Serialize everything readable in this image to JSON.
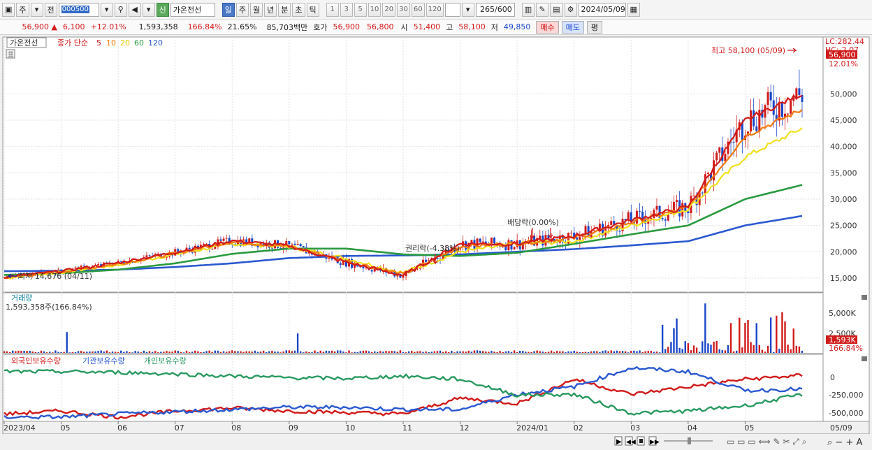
{
  "toolbar": {
    "market_label": "주",
    "prev_label": "전",
    "symbol_code": "000500",
    "new_badge": "신",
    "stock_name": "가온전선",
    "period_buttons": [
      "일",
      "주",
      "월",
      "년",
      "분",
      "초",
      "틱"
    ],
    "interval_buttons": [
      "1",
      "3",
      "5",
      "10",
      "20",
      "30",
      "60",
      "120"
    ],
    "count_value": "265",
    "count_total": "/600",
    "date_value": "2024/05/09"
  },
  "quote": {
    "price": "56,900",
    "change_arrow": "▲",
    "change": "6,100",
    "change_pct": "+12.01%",
    "volume": "1,593,358",
    "volume_ratio": "166.84%",
    "turnover_rate": "21.65%",
    "amount": "85,703백만",
    "bid_label": "호가",
    "ask_price": "56,900",
    "bid_price": "56,800",
    "open_label": "시",
    "open": "51,400",
    "high_label": "고",
    "high": "58,100",
    "low_label": "저",
    "low": "49,850",
    "buy_button": "매수",
    "sell_button": "매도",
    "eval_button": "평"
  },
  "price_panel": {
    "stock_name_tag": "가온전선",
    "ma_label_main": "종가 단순",
    "ma_periods": [
      "5",
      "10",
      "20",
      "60",
      "120"
    ],
    "ma_colors": [
      "#d11a1a",
      "#f07a10",
      "#f0e020",
      "#2a9a40",
      "#2a58d0"
    ],
    "lc_label": "LC:282.44",
    "hc_label": "HC:-2.07",
    "current_price_tag": "56,900",
    "current_pct_tag": "12.01%",
    "high_annotation": "최고 58,100 (05/09)",
    "low_annotation": "최저 14,676 (04/11)",
    "event_rights": "권리락(-4.38%)",
    "event_dividend": "배당락(0.00%)",
    "y_ticks": [
      "50,000",
      "45,000",
      "40,000",
      "35,000",
      "30,000",
      "25,000",
      "20,000",
      "15,000"
    ]
  },
  "volume_panel": {
    "title": "거래량",
    "value_text": "1,593,358주(166.84%)",
    "y_ticks": [
      "5,000K",
      "2,500K"
    ],
    "current_tag": "1,593K",
    "current_pct_tag": "166.84%"
  },
  "holdings_panel": {
    "legend": [
      "외국인보유수량",
      "기관보유수량",
      "개인보유수량"
    ],
    "legend_colors": [
      "#d11a1a",
      "#2a58d0",
      "#2a9a60"
    ],
    "y_ticks": [
      "0",
      "-250,000",
      "-500,000"
    ]
  },
  "x_axis": {
    "labels": [
      "2023/04",
      "05",
      "06",
      "07",
      "08",
      "09",
      "10",
      "11",
      "12",
      "2024/01",
      "02",
      "03",
      "04",
      "05"
    ],
    "right_label": "05/09"
  },
  "chart_data": {
    "type": "line",
    "title": "",
    "xlabel": "",
    "ylabel": "",
    "x": [
      "2023/04",
      "05",
      "06",
      "07",
      "08",
      "09",
      "10",
      "11",
      "12",
      "2024/01",
      "02",
      "03",
      "04",
      "05",
      "05/09"
    ],
    "ylim": [
      13000,
      60000
    ],
    "series": [
      {
        "name": "5",
        "values": [
          15200,
          16300,
          17900,
          19900,
          22100,
          21100,
          18000,
          15500,
          21500,
          21500,
          23000,
          26000,
          28500,
          45000,
          50000
        ]
      },
      {
        "name": "10",
        "values": [
          15100,
          16200,
          17700,
          19700,
          21900,
          21000,
          18300,
          15700,
          21000,
          21600,
          22600,
          25600,
          28400,
          42000,
          47000
        ]
      },
      {
        "name": "20",
        "values": [
          15000,
          16100,
          17500,
          19500,
          21500,
          21000,
          18700,
          16000,
          20000,
          21500,
          22000,
          25000,
          28200,
          38000,
          43500
        ]
      },
      {
        "name": "60",
        "values": [
          15600,
          15900,
          16600,
          17800,
          19600,
          20600,
          20600,
          19500,
          19200,
          19800,
          21500,
          23300,
          25000,
          30000,
          32700
        ]
      },
      {
        "name": "120",
        "values": [
          16300,
          16400,
          16600,
          17100,
          17800,
          18800,
          19200,
          19300,
          19500,
          20000,
          20500,
          21200,
          22000,
          25000,
          26800
        ]
      }
    ]
  }
}
